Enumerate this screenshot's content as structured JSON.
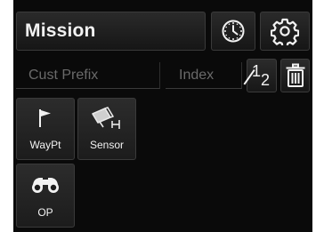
{
  "header": {
    "title": "Mission",
    "clock_icon": "clock-icon",
    "settings_icon": "gear-icon"
  },
  "fields": {
    "prefix_placeholder": "Cust Prefix",
    "index_placeholder": "Index",
    "order_icon": "fraction-1-2-icon",
    "order_numerator": "1",
    "order_denominator": "2",
    "delete_icon": "trash-icon"
  },
  "tiles": [
    {
      "label": "WayPt",
      "icon": "flag-icon"
    },
    {
      "label": "Sensor",
      "icon": "camera-icon"
    },
    {
      "label": "OP",
      "icon": "binoculars-icon"
    }
  ],
  "colors": {
    "background": "#0a0a0a",
    "button": "#222222",
    "text": "#f2f2f2",
    "placeholder": "#6a6a6a"
  }
}
